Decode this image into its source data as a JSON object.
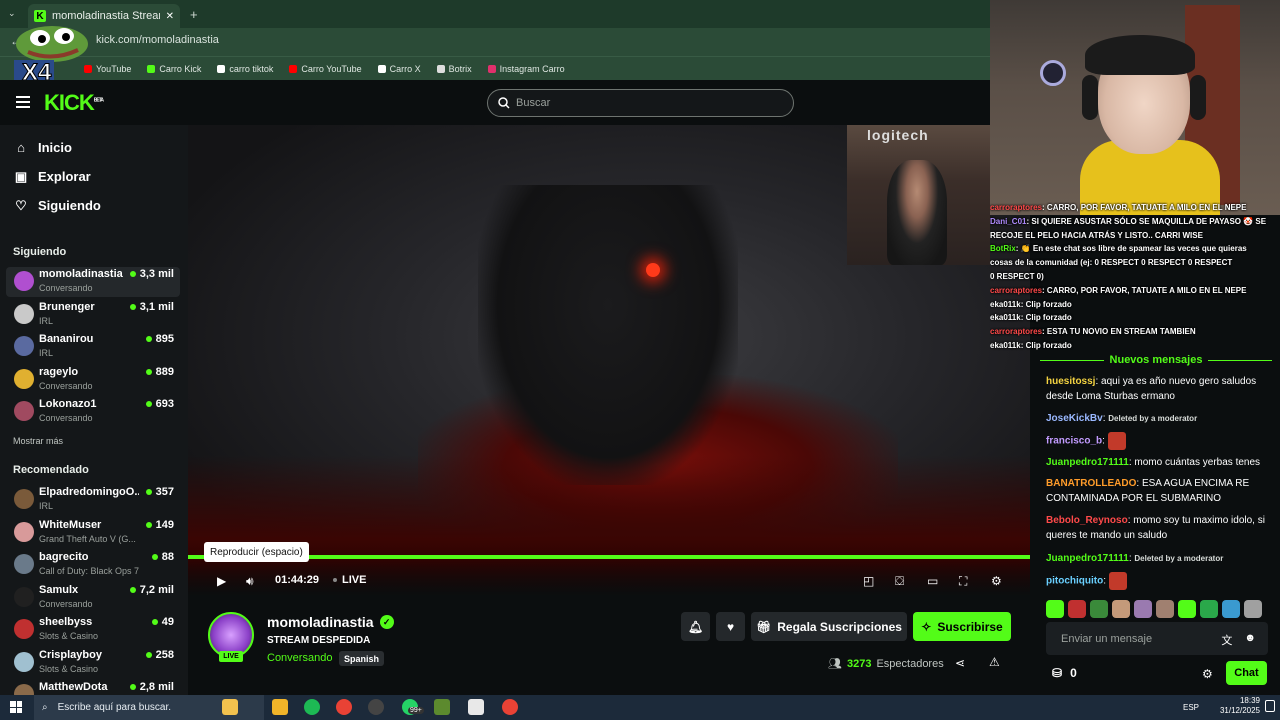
{
  "browser": {
    "tab_title": "momoladinastia Stream - Watc",
    "url": "kick.com/momoladinastia",
    "bookmarks": [
      {
        "label": "YouTube",
        "color": "#ff0000"
      },
      {
        "label": "Carro Kick",
        "color": "#53fc18"
      },
      {
        "label": "carro tiktok",
        "color": "#ffffff"
      },
      {
        "label": "Carro YouTube",
        "color": "#ff0000"
      },
      {
        "label": "Carro X",
        "color": "#ffffff"
      },
      {
        "label": "Botrix",
        "color": "#dddddd"
      },
      {
        "label": "Instagram Carro",
        "color": "#e1306c"
      }
    ]
  },
  "overlay": {
    "frog_text": "X4"
  },
  "header": {
    "logo": "KICK",
    "logo_badge": "BETA",
    "search_placeholder": "Buscar"
  },
  "sidebar": {
    "nav": [
      {
        "label": "Inicio",
        "icon": "home-icon"
      },
      {
        "label": "Explorar",
        "icon": "compass-icon"
      },
      {
        "label": "Siguiendo",
        "icon": "heart-icon"
      }
    ],
    "following_title": "Siguiendo",
    "following": [
      {
        "name": "momoladinastia",
        "category": "Conversando",
        "viewers": "3,3 mil",
        "color": "#b04fd0"
      },
      {
        "name": "Brunenger",
        "category": "IRL",
        "viewers": "3,1 mil",
        "color": "#c9c9c9"
      },
      {
        "name": "Bananirou",
        "category": "IRL",
        "viewers": "895",
        "color": "#5a6aa0"
      },
      {
        "name": "rageylo",
        "category": "Conversando",
        "viewers": "889",
        "color": "#e0b030"
      },
      {
        "name": "Lokonazo1",
        "category": "Conversando",
        "viewers": "693",
        "color": "#a04a60"
      }
    ],
    "show_more": "Mostrar más",
    "recommended_title": "Recomendado",
    "recommended": [
      {
        "name": "ElpadredomingoO...",
        "category": "IRL",
        "viewers": "357",
        "color": "#7a5a3a"
      },
      {
        "name": "WhiteMuser",
        "category": "Grand Theft Auto V (G...",
        "viewers": "149",
        "color": "#d89a9a"
      },
      {
        "name": "bagrecito",
        "category": "Call of Duty: Black Ops 7",
        "viewers": "88",
        "color": "#6a7a8a"
      },
      {
        "name": "Samulx",
        "category": "Conversando",
        "viewers": "7,2 mil",
        "color": "#202020"
      },
      {
        "name": "sheelbyss",
        "category": "Slots & Casino",
        "viewers": "49",
        "color": "#c03030"
      },
      {
        "name": "Crisplayboy",
        "category": "Slots & Casino",
        "viewers": "258",
        "color": "#a0c0d0"
      },
      {
        "name": "MatthewDota",
        "category": "",
        "viewers": "2,8 mil",
        "color": "#8a6a4a"
      }
    ]
  },
  "player": {
    "tooltip": "Reproducir (espacio)",
    "time": "01:44:29",
    "live": "LIVE",
    "cam_sign": "logitech"
  },
  "channel": {
    "name": "momoladinastia",
    "title": "STREAM DESPEDIDA",
    "category": "Conversando",
    "language": "Spanish",
    "live_badge": "LIVE",
    "gift_label": "Regala Suscripciones",
    "subscribe_label": "Suscribirse",
    "viewers_count": "3273",
    "viewers_label": "Espectadores"
  },
  "overlay_chat": [
    {
      "user": "carroraptores",
      "text": ": CARRO, POR FAVOR, TATUATE A MILO EN EL NEPE"
    },
    {
      "user": "Dani_C01",
      "text": ": SI QUIERE ASUSTAR SÓLO SE MAQUILLA DE PAYASO 🤡 SE"
    },
    {
      "user": "",
      "text": "RECOJE EL PELO HACIA ATRÁS Y LISTO.. CARRI WISE"
    },
    {
      "user": "BotRix",
      "text": ": 👏 En este chat sos libre de spamear las veces que quieras"
    },
    {
      "user": "",
      "text": "cosas de la comunidad (ej: 0  RESPECT  0  RESPECT  0  RESPECT"
    },
    {
      "user": "",
      "text": "0  RESPECT  0)"
    },
    {
      "user": "carroraptores",
      "text": ": CARRO, POR FAVOR, TATUATE A MILO EN EL NEPE"
    },
    {
      "user": "eka011k",
      "text": ": Clip forzado"
    },
    {
      "user": "eka011k",
      "text": ": Clip forzado"
    },
    {
      "user": "carroraptores",
      "text": ": ESTA TU NOVIO EN STREAM TAMBIEN"
    },
    {
      "user": "eka011k",
      "text": ": Clip forzado"
    }
  ],
  "chat": {
    "new_messages": "Nuevos mensajes",
    "messages": [
      {
        "user": "huesitossj",
        "color": "#f5d442",
        "text": "aqui ya es año nuevo gero saludos desde Loma Sturbas ermano",
        "mod": false
      },
      {
        "user": "JoseKickBv",
        "color": "#9ab8ff",
        "text": "Deleted by a moderator",
        "mod": true
      },
      {
        "user": "francisco_b",
        "color": "#c29bff",
        "text": "",
        "mod": false,
        "emote": true
      },
      {
        "user": "Juanpedro171111",
        "color": "#53fc18",
        "text": "momo cuántas yerbas tenes",
        "mod": false
      },
      {
        "user": "BANATROLLEADO",
        "color": "#ff9c2a",
        "text": "ESA AGUA ENCIMA RE CONTAMINADA POR EL SUBMARINO",
        "mod": false
      },
      {
        "user": "Bebolo_Reynoso",
        "color": "#ff4a4a",
        "text": "momo soy tu maximo idolo, si queres te mando un saludo",
        "mod": false
      },
      {
        "user": "Juanpedro171111",
        "color": "#53fc18",
        "text": "Deleted by a moderator",
        "mod": true
      },
      {
        "user": "pitochiquito",
        "color": "#6ad0ff",
        "text": "",
        "mod": false,
        "emote": true
      }
    ],
    "emote_colors": [
      "#53fc18",
      "#c03030",
      "#3a8a3a",
      "#c49a7a",
      "#9a7ab0",
      "#a08070",
      "#53fc18",
      "#2aa84a",
      "#3a9ad0",
      "#a0a0a0"
    ],
    "input_placeholder": "Enviar un mensaje",
    "points": "0",
    "chat_button": "Chat"
  },
  "taskbar": {
    "search_placeholder": "Escribe aquí para buscar.",
    "badge": "99+",
    "lang": "ESP",
    "time": "18:39",
    "date": "31/12/2025"
  }
}
